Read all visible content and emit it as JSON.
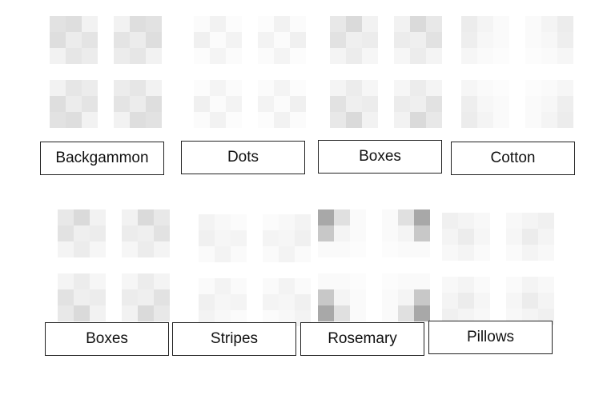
{
  "colors": {
    "border": "#222222",
    "text": "#111111"
  },
  "patterns": [
    {
      "label": "Backgammon",
      "icon": "backgammon-pattern-icon",
      "scheme": "backgammon"
    },
    {
      "label": "Dots",
      "icon": "dots-pattern-icon",
      "scheme": "dots"
    },
    {
      "label": "Boxes",
      "icon": "boxes-pattern-icon",
      "scheme": "boxes"
    },
    {
      "label": "Cotton",
      "icon": "cotton-pattern-icon",
      "scheme": "cotton"
    },
    {
      "label": "Boxes",
      "icon": "boxes-pattern-icon",
      "scheme": "boxes"
    },
    {
      "label": "Stripes",
      "icon": "stripes-pattern-icon",
      "scheme": "stripes"
    },
    {
      "label": "Rosemary",
      "icon": "rosemary-pattern-icon",
      "scheme": "rosemary"
    },
    {
      "label": "Pillows",
      "icon": "pillows-pattern-icon",
      "scheme": "pillows"
    }
  ]
}
